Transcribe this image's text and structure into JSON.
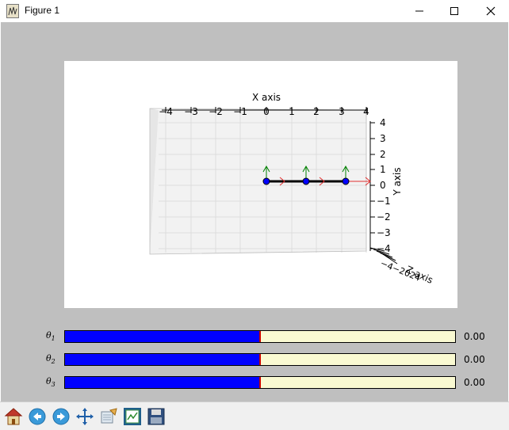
{
  "window": {
    "title": "Figure 1"
  },
  "plot": {
    "x_axis_label": "X axis",
    "y_axis_label": "Y axis",
    "z_axis_label": "Z axis",
    "x_ticks": [
      "−4",
      "−3",
      "−2",
      "−1",
      "0",
      "1",
      "2",
      "3",
      "4"
    ],
    "y_ticks": [
      "4",
      "3",
      "2",
      "1",
      "0",
      "−1",
      "−2",
      "−3",
      "−4"
    ],
    "link_color": "#000000",
    "joint_color": "#0000ff",
    "x_arrow_color": "#ff0000",
    "y_arrow_color": "#008000"
  },
  "sliders": [
    {
      "symbol": "θ",
      "index": "1",
      "value": "0.00",
      "fill_fraction": 0.5
    },
    {
      "symbol": "θ",
      "index": "2",
      "value": "0.00",
      "fill_fraction": 0.5
    },
    {
      "symbol": "θ",
      "index": "3",
      "value": "0.00",
      "fill_fraction": 0.5
    }
  ],
  "slider_colors": {
    "fill": "#0000ff",
    "track": "#fafad2",
    "handle": "#cc0000"
  },
  "toolbar": {
    "buttons": [
      {
        "icon": "home-icon"
      },
      {
        "icon": "back-arrow-icon"
      },
      {
        "icon": "forward-arrow-icon"
      },
      {
        "icon": "pan-icon"
      },
      {
        "icon": "zoom-icon"
      },
      {
        "icon": "subplots-icon"
      },
      {
        "icon": "save-icon"
      }
    ]
  }
}
